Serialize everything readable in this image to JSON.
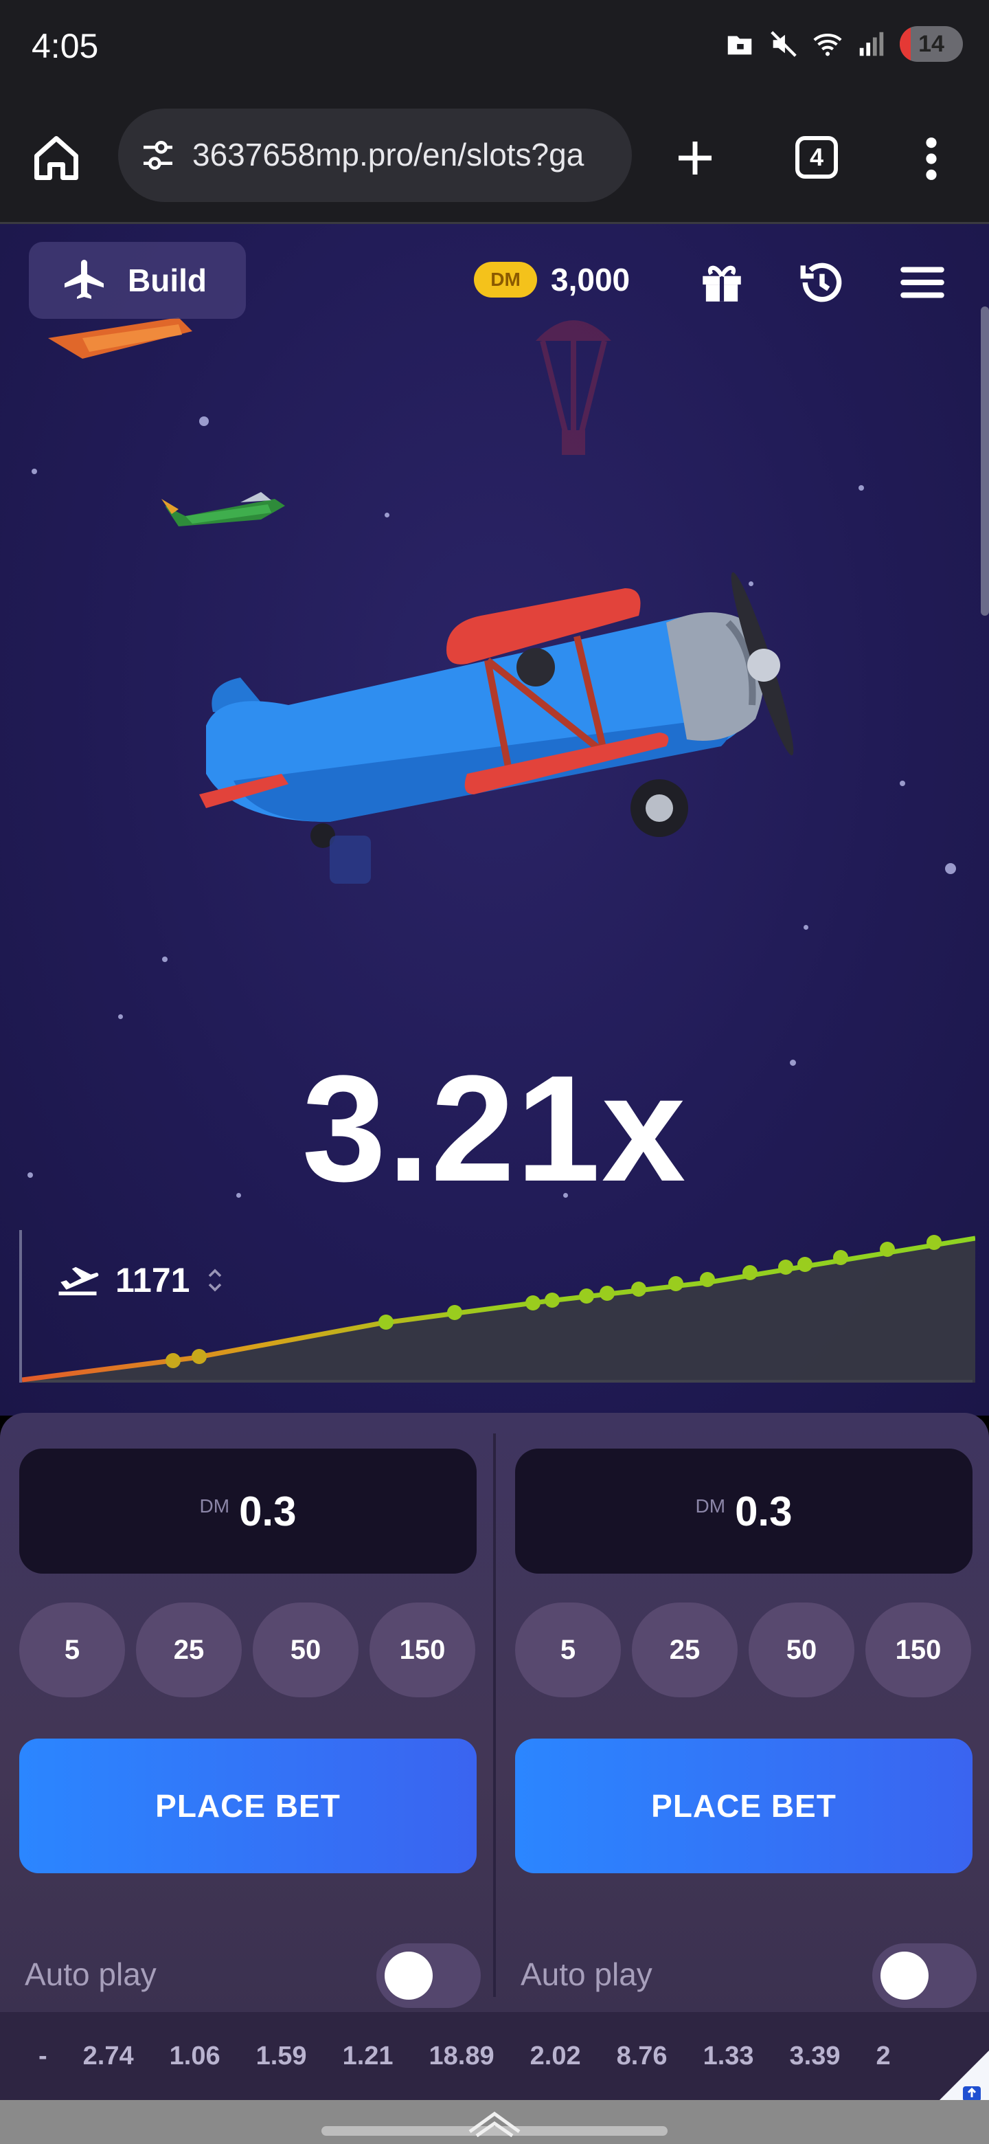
{
  "status_bar": {
    "time": "4:05",
    "battery": "14"
  },
  "browser": {
    "url": "3637658mp.pro/en/slots?ga",
    "tab_count": "4"
  },
  "game": {
    "mode_button": "Build",
    "currency": "DM",
    "balance": "3,000",
    "multiplier": "3.21x",
    "altitude": "1171"
  },
  "bets": [
    {
      "currency": "DM",
      "amount": "0.3",
      "chips": [
        "5",
        "25",
        "50",
        "150"
      ],
      "place_bet": "PLACE BET",
      "auto_play": "Auto play"
    },
    {
      "currency": "DM",
      "amount": "0.3",
      "chips": [
        "5",
        "25",
        "50",
        "150"
      ],
      "place_bet": "PLACE BET",
      "auto_play": "Auto play"
    }
  ],
  "history": [
    "-",
    "2.74",
    "1.06",
    "1.59",
    "1.21",
    "18.89",
    "2.02",
    "8.76",
    "1.33",
    "3.39",
    "2"
  ],
  "colors": {
    "background": "#211b56",
    "accent_blue": "#2b86ff",
    "coin": "#f4c21b",
    "curve_green": "#9acd1e"
  }
}
